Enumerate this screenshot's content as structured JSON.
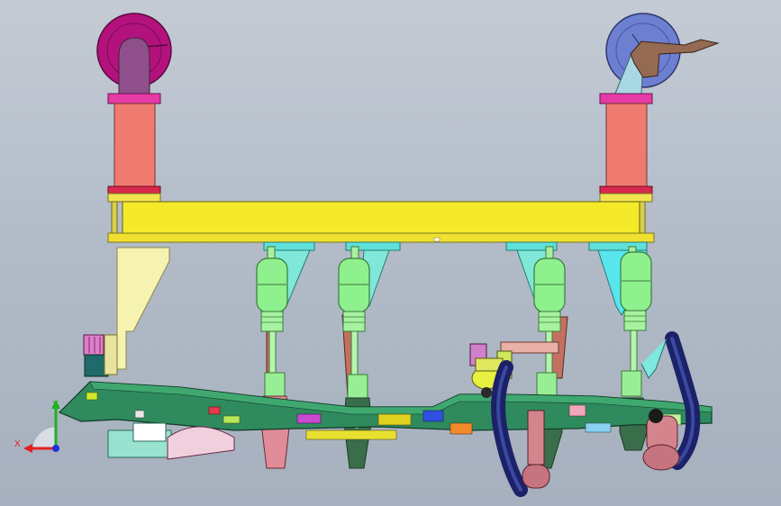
{
  "viewport": {
    "background_top": "#c4cbd5",
    "background_bottom": "#a6b0be"
  },
  "model": {
    "colors": {
      "left_wheel": "#b3127c",
      "right_wheel": "#6d7fd0",
      "column": "#ee7a70",
      "flange": "#e63aa6",
      "beam": "#f4ea2a",
      "cylinder": "#8ff08e",
      "bracket_cyan": "#5fe0d8",
      "fixture_base": "#47b06c",
      "hose": "#1c2168",
      "clamp_pink": "#e08c98"
    }
  },
  "triad": {
    "x_label": "X",
    "y_label": "Y",
    "x_color": "#e02020",
    "y_color": "#20b020",
    "z_color": "#2030e0"
  }
}
